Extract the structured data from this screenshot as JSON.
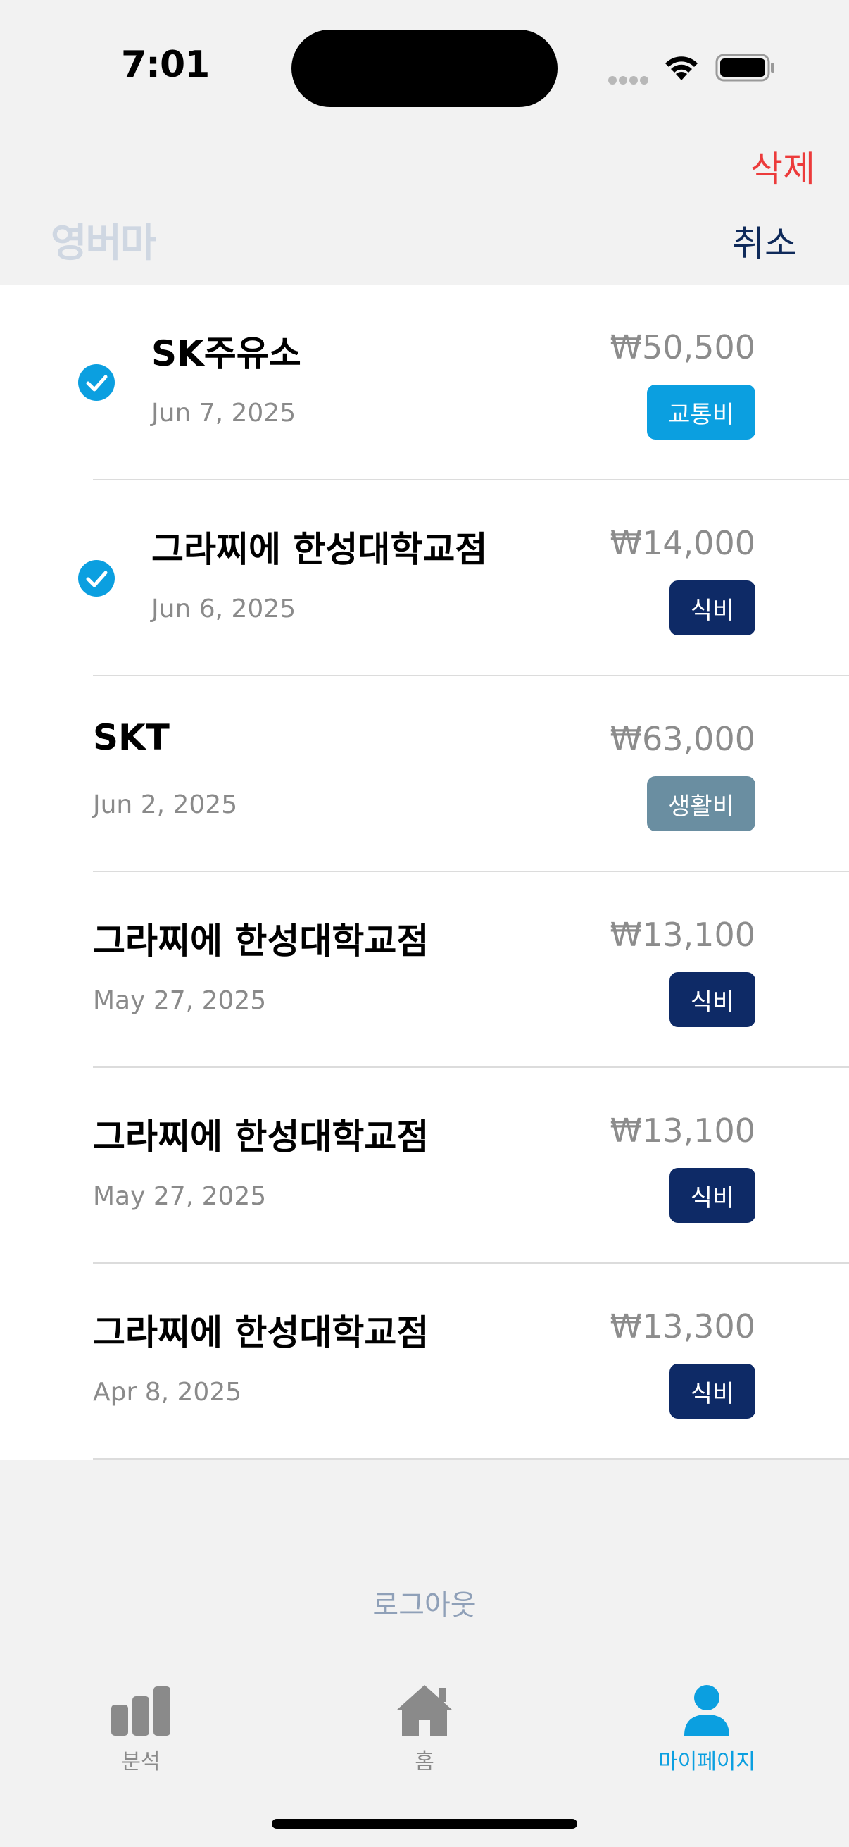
{
  "status_bar": {
    "time": "7:01"
  },
  "header": {
    "delete_label": "삭제",
    "brand": "영버마",
    "cancel_label": "취소"
  },
  "colors": {
    "delete": "#ec3b3b",
    "accent": "#0b9fe0",
    "badge_transport": "#0b9fe0",
    "badge_food": "#0e2a66",
    "badge_living": "#6a8ea1"
  },
  "transactions": [
    {
      "title": "SK주유소",
      "date": "Jun 7, 2025",
      "amount": "₩50,500",
      "category": "교통비",
      "selected": true
    },
    {
      "title": "그라찌에 한성대학교점",
      "date": "Jun 6, 2025",
      "amount": "₩14,000",
      "category": "식비",
      "selected": true
    },
    {
      "title": "SKT",
      "date": "Jun 2, 2025",
      "amount": "₩63,000",
      "category": "생활비",
      "selected": false
    },
    {
      "title": "그라찌에 한성대학교점",
      "date": "May 27, 2025",
      "amount": "₩13,100",
      "category": "식비",
      "selected": false
    },
    {
      "title": "그라찌에 한성대학교점",
      "date": "May 27, 2025",
      "amount": "₩13,100",
      "category": "식비",
      "selected": false
    },
    {
      "title": "그라찌에 한성대학교점",
      "date": "Apr 8, 2025",
      "amount": "₩13,300",
      "category": "식비",
      "selected": false
    }
  ],
  "logout_label": "로그아웃",
  "tab_bar": {
    "items": [
      {
        "label": "분석",
        "icon": "bar-chart-icon",
        "active": false
      },
      {
        "label": "홈",
        "icon": "home-icon",
        "active": false
      },
      {
        "label": "마이페이지",
        "icon": "person-icon",
        "active": true
      }
    ]
  }
}
